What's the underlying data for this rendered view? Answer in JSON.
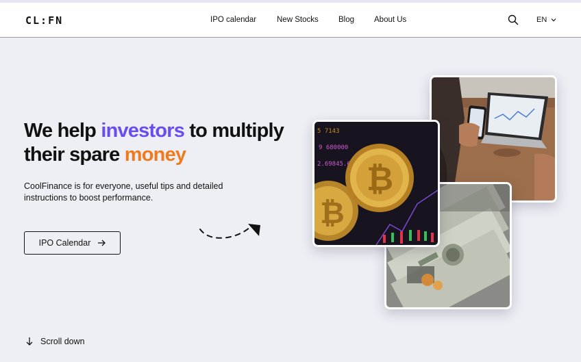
{
  "header": {
    "logo": "CL:FN",
    "nav": [
      {
        "label": "IPO calendar"
      },
      {
        "label": "New Stocks"
      },
      {
        "label": "Blog"
      },
      {
        "label": "About Us"
      }
    ],
    "language": "EN",
    "icons": [
      "search-icon",
      "chevron-down-icon"
    ]
  },
  "hero": {
    "headline_part1": "We help ",
    "headline_highlight1": "investors",
    "headline_part2": " to multiply their spare ",
    "headline_highlight2": "money",
    "subtitle": "CoolFinance is for everyone, useful tips and detailed instructions to boost performance.",
    "cta_label": "IPO Calendar",
    "scroll_label": "Scroll down"
  },
  "colors": {
    "background": "#eeeef5",
    "accent_purple": "#6a4cf0",
    "accent_orange": "#f07b1e",
    "text": "#111111"
  },
  "images": [
    {
      "name": "laptop-phone-photo"
    },
    {
      "name": "dollar-bills-photo"
    },
    {
      "name": "bitcoin-coins-photo"
    }
  ]
}
